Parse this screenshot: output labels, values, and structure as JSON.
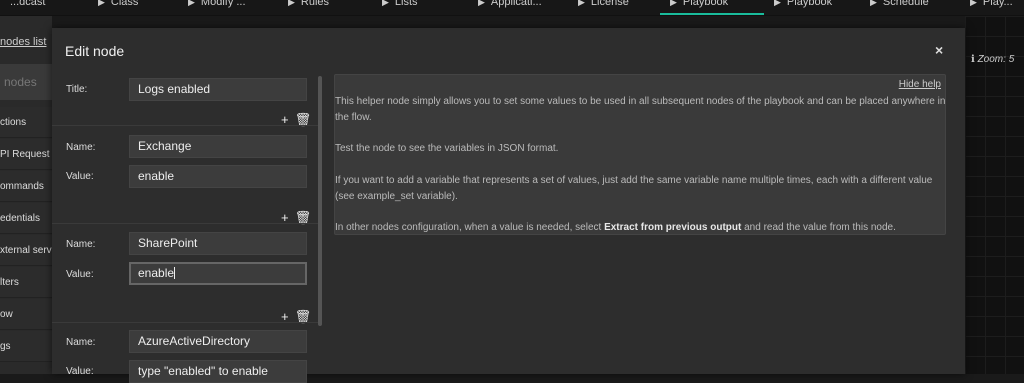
{
  "topbar": {
    "tabs": [
      {
        "label": "...dcast",
        "active": false
      },
      {
        "label": "Class",
        "active": false
      },
      {
        "label": "Modify ...",
        "active": false
      },
      {
        "label": "Rules",
        "active": false
      },
      {
        "label": "Lists",
        "active": false
      },
      {
        "label": "Applicati...",
        "active": false
      },
      {
        "label": "License",
        "active": false
      },
      {
        "label": "Playbook",
        "active": true
      },
      {
        "label": "Playbook",
        "active": false
      },
      {
        "label": "Schedule",
        "active": false
      },
      {
        "label": "Play...",
        "active": false
      }
    ],
    "accent": "#1abc9c"
  },
  "sidebar": {
    "back_link": "nodes list",
    "nodes_header": "nodes",
    "items": [
      "ctions",
      "PI Request",
      "ommands",
      "edentials",
      "xternal servi",
      "lters",
      "ow",
      "gs"
    ]
  },
  "canvas": {
    "zoom_label": "Zoom: 5"
  },
  "modal": {
    "title": "Edit node",
    "close_symbol": "×",
    "title_field": {
      "label": "Title:",
      "value": "Logs enabled"
    },
    "variables": [
      {
        "name_label": "Name:",
        "name": "Exchange",
        "value_label": "Value:",
        "value": "enable"
      },
      {
        "name_label": "Name:",
        "name": "SharePoint",
        "value_label": "Value:",
        "value": "enable"
      },
      {
        "name_label": "Name:",
        "name": "AzureActiveDirectory",
        "value_label": "Value:",
        "value": "type \"enabled\" to enable"
      }
    ],
    "add_icon": "+",
    "delete_icon": "🗑",
    "help": {
      "hide_label": "Hide help",
      "p1": "This helper node simply allows you to set some values to be used in all subsequent nodes of the playbook and can be placed anywhere in the flow.",
      "p2": "Test the node to see the variables in JSON format.",
      "p3": "If you want to add a variable that represents a set of values, just add the same variable name multiple times, each with a different value (see example_set variable).",
      "p4_before": "In other nodes configuration, when a value is needed, select ",
      "p4_bold": "Extract from previous output",
      "p4_after": " and read the value from this node."
    }
  }
}
